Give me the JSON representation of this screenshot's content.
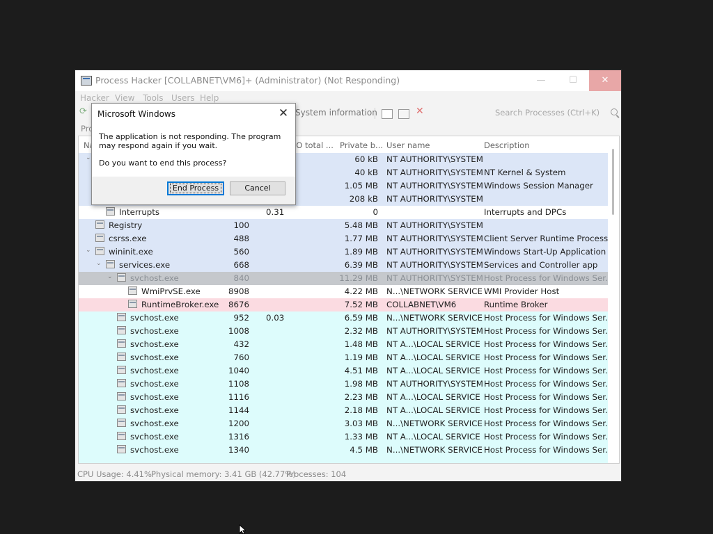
{
  "window": {
    "title": "Process Hacker [COLLABNET\\VM6]+ (Administrator) (Not Responding)",
    "minimize": "—",
    "maximize": "☐",
    "close": "✕"
  },
  "menu": [
    "Hacker",
    "View",
    "Tools",
    "Users",
    "Help"
  ],
  "toolbar": {
    "system_information": "System information",
    "search_placeholder": "Search Processes (Ctrl+K)"
  },
  "tabs": {
    "first_tab_partial": "Pro"
  },
  "columns": {
    "name": "Na",
    "pid": "",
    "cpu": "",
    "io_total": "I/O total ...",
    "private_bytes": "Private b...",
    "user_name": "User name",
    "description": "Description"
  },
  "processes": [
    {
      "name": "",
      "pid": "",
      "cpu": "",
      "private": "60 kB",
      "user": "NT AUTHORITY\\SYSTEM",
      "desc": ""
    },
    {
      "name": "",
      "pid": "",
      "cpu": "",
      "private": "40 kB",
      "user": "NT AUTHORITY\\SYSTEM",
      "desc": "NT Kernel & System"
    },
    {
      "name": "",
      "pid": "",
      "cpu": "",
      "private": "1.05 MB",
      "user": "NT AUTHORITY\\SYSTEM",
      "desc": "Windows Session Manager"
    },
    {
      "name": "",
      "pid": "",
      "cpu": "",
      "private": "208 kB",
      "user": "NT AUTHORITY\\SYSTEM",
      "desc": ""
    },
    {
      "name": "Interrupts",
      "pid": "",
      "cpu": "0.31",
      "private": "0",
      "user": "",
      "desc": "Interrupts and DPCs"
    },
    {
      "name": "Registry",
      "pid": "100",
      "cpu": "",
      "private": "5.48 MB",
      "user": "NT AUTHORITY\\SYSTEM",
      "desc": ""
    },
    {
      "name": "csrss.exe",
      "pid": "488",
      "cpu": "",
      "private": "1.77 MB",
      "user": "NT AUTHORITY\\SYSTEM",
      "desc": "Client Server Runtime Process"
    },
    {
      "name": "wininit.exe",
      "pid": "560",
      "cpu": "",
      "private": "1.89 MB",
      "user": "NT AUTHORITY\\SYSTEM",
      "desc": "Windows Start-Up Application"
    },
    {
      "name": "services.exe",
      "pid": "668",
      "cpu": "",
      "private": "6.39 MB",
      "user": "NT AUTHORITY\\SYSTEM",
      "desc": "Services and Controller app"
    },
    {
      "name": "svchost.exe",
      "pid": "840",
      "cpu": "",
      "private": "11.29 MB",
      "user": "NT AUTHORITY\\SYSTEM",
      "desc": "Host Process for Windows Ser..."
    },
    {
      "name": "WmiPrvSE.exe",
      "pid": "8908",
      "cpu": "",
      "private": "4.22 MB",
      "user": "N...\\NETWORK SERVICE",
      "desc": "WMI Provider Host"
    },
    {
      "name": "RuntimeBroker.exe",
      "pid": "8676",
      "cpu": "",
      "private": "7.52 MB",
      "user": "COLLABNET\\VM6",
      "desc": "Runtime Broker"
    },
    {
      "name": "svchost.exe",
      "pid": "952",
      "cpu": "0.03",
      "private": "6.59 MB",
      "user": "N...\\NETWORK SERVICE",
      "desc": "Host Process for Windows Ser..."
    },
    {
      "name": "svchost.exe",
      "pid": "1008",
      "cpu": "",
      "private": "2.32 MB",
      "user": "NT AUTHORITY\\SYSTEM",
      "desc": "Host Process for Windows Ser..."
    },
    {
      "name": "svchost.exe",
      "pid": "432",
      "cpu": "",
      "private": "1.48 MB",
      "user": "NT A...\\LOCAL SERVICE",
      "desc": "Host Process for Windows Ser..."
    },
    {
      "name": "svchost.exe",
      "pid": "760",
      "cpu": "",
      "private": "1.19 MB",
      "user": "NT A...\\LOCAL SERVICE",
      "desc": "Host Process for Windows Ser..."
    },
    {
      "name": "svchost.exe",
      "pid": "1040",
      "cpu": "",
      "private": "4.51 MB",
      "user": "NT A...\\LOCAL SERVICE",
      "desc": "Host Process for Windows Ser..."
    },
    {
      "name": "svchost.exe",
      "pid": "1108",
      "cpu": "",
      "private": "1.98 MB",
      "user": "NT AUTHORITY\\SYSTEM",
      "desc": "Host Process for Windows Ser..."
    },
    {
      "name": "svchost.exe",
      "pid": "1116",
      "cpu": "",
      "private": "2.23 MB",
      "user": "NT A...\\LOCAL SERVICE",
      "desc": "Host Process for Windows Ser..."
    },
    {
      "name": "svchost.exe",
      "pid": "1144",
      "cpu": "",
      "private": "2.18 MB",
      "user": "NT A...\\LOCAL SERVICE",
      "desc": "Host Process for Windows Ser..."
    },
    {
      "name": "svchost.exe",
      "pid": "1200",
      "cpu": "",
      "private": "3.03 MB",
      "user": "N...\\NETWORK SERVICE",
      "desc": "Host Process for Windows Ser..."
    },
    {
      "name": "svchost.exe",
      "pid": "1316",
      "cpu": "",
      "private": "1.33 MB",
      "user": "NT A...\\LOCAL SERVICE",
      "desc": "Host Process for Windows Ser..."
    },
    {
      "name": "svchost.exe",
      "pid": "1340",
      "cpu": "",
      "private": "4.5 MB",
      "user": "N...\\NETWORK SERVICE",
      "desc": "Host Process for Windows Ser..."
    }
  ],
  "colors": {
    "system_row": "#dce6f7",
    "service_row": "#ddfcfc",
    "selected_row": "#c5c8cc",
    "own_process_row": "#fbdbe1",
    "close_button": "#e8a7a7"
  },
  "status": {
    "cpu": "CPU Usage: 4.41%",
    "memory": "Physical memory: 3.41 GB (42.77%)",
    "processes": "Processes: 104"
  },
  "dialog": {
    "title": "Microsoft Windows",
    "message": "The application is not responding. The program may respond again if you wait.",
    "question": "Do you want to end this process?",
    "end_button": "End Process",
    "cancel_button": "Cancel",
    "close": "✕"
  }
}
